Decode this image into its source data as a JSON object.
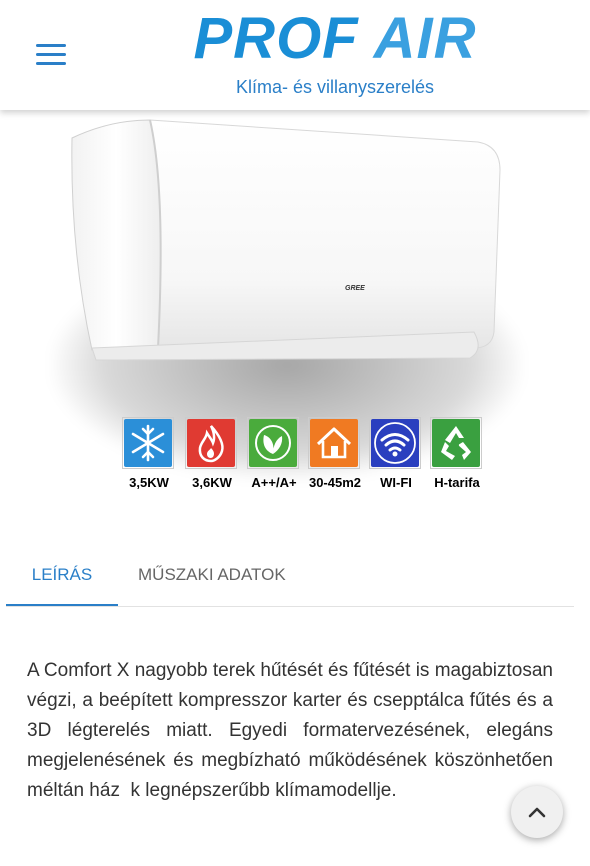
{
  "header": {
    "brand_part1": "PROF",
    "brand_part2": "AIR",
    "tagline": "Klíma- és villanyszerelés",
    "menu_icon": "hamburger-menu-icon",
    "accent_color": "#2a7fc8"
  },
  "product": {
    "unit_brand": "GREE",
    "features": [
      {
        "label": "3,5KW",
        "icon": "snowflake-icon",
        "color": "#2b8fd8"
      },
      {
        "label": "3,6KW",
        "icon": "flame-icon",
        "color": "#e03a32"
      },
      {
        "label": "A++/A+",
        "icon": "leaves-icon",
        "color": "#4aab3c"
      },
      {
        "label": "30-45m2",
        "icon": "house-icon",
        "color": "#f07a22"
      },
      {
        "label": "WI-FI",
        "icon": "wifi-icon",
        "color": "#2a3fbf"
      },
      {
        "label": "H-tarifa",
        "icon": "recycle-icon",
        "color": "#3aa040"
      }
    ]
  },
  "tabs": [
    {
      "label": "LEÍRÁS",
      "active": true
    },
    {
      "label": "MŰSZAKI ADATOK",
      "active": false
    }
  ],
  "description": "A Comfort X nagyobb terek hűtését és fűtését is magabiztosan végzi, a beépített kompresszor karter és csepptálca fűtés és a 3D légterelés miatt. Egyedi formatervezésének, elegáns megjelenésének és megbízható működésének köszönhetően méltán ház  k legnépszerűbb klímamodellje.",
  "scroll_top_icon": "chevron-up-icon"
}
